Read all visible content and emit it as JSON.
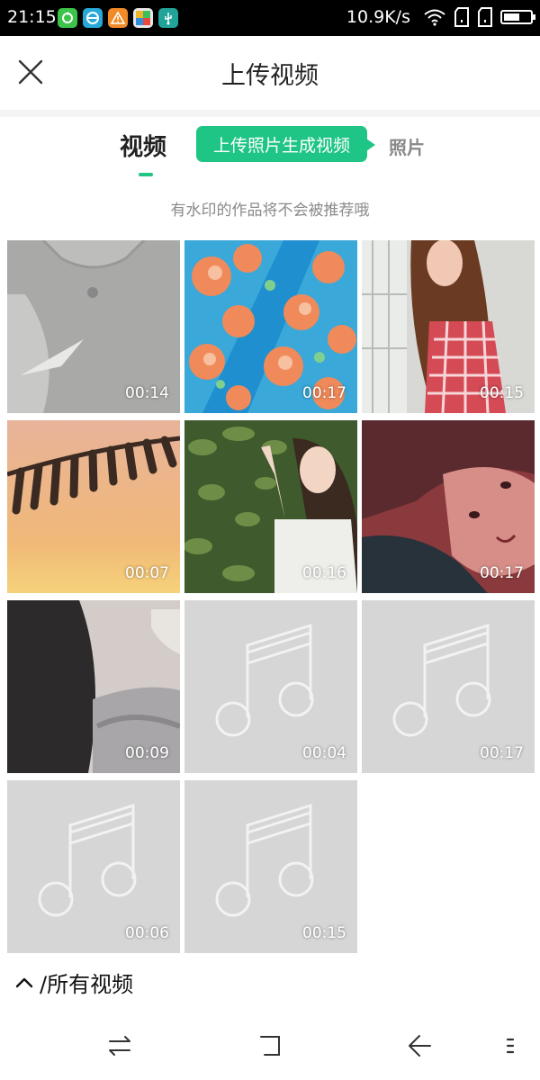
{
  "status_bar": {
    "time": "21:15",
    "network_speed": "10.9K/s",
    "notification_icons": [
      "sync-app-icon",
      "browser-app-icon",
      "warning-icon",
      "gallery-app-icon",
      "usb-icon"
    ],
    "battery_level": 0.6
  },
  "header": {
    "title": "上传视频",
    "close_icon": "close-icon"
  },
  "tabs": {
    "video_label": "视频",
    "photo_label": "照片",
    "active": "video",
    "accent_color": "#20c585"
  },
  "promo_badge": "上传照片生成视频",
  "watermark_note": "有水印的作品将不会被推荐哦",
  "videos": [
    {
      "duration": "00:14",
      "thumb": "man-grey-tshirt"
    },
    {
      "duration": "00:17",
      "thumb": "orange-flowers-blue-water"
    },
    {
      "duration": "00:15",
      "thumb": "woman-red-gingham-dress"
    },
    {
      "duration": "00:07",
      "thumb": "fern-leaf-sunset"
    },
    {
      "duration": "00:16",
      "thumb": "woman-white-dress-leaves"
    },
    {
      "duration": "00:17",
      "thumb": "woman-lying-red-tint"
    },
    {
      "duration": "00:09",
      "thumb": "grey-cat"
    },
    {
      "duration": "00:04",
      "thumb": "music-placeholder"
    },
    {
      "duration": "00:17",
      "thumb": "music-placeholder"
    },
    {
      "duration": "00:06",
      "thumb": "music-placeholder"
    },
    {
      "duration": "00:15",
      "thumb": "music-placeholder"
    }
  ],
  "album_selector": {
    "label": "/所有视频",
    "icon": "chevron-up-icon"
  },
  "nav_bar": [
    "switch-apps-icon",
    "home-square-icon",
    "back-arrow-icon",
    "menu-dots-icon"
  ]
}
